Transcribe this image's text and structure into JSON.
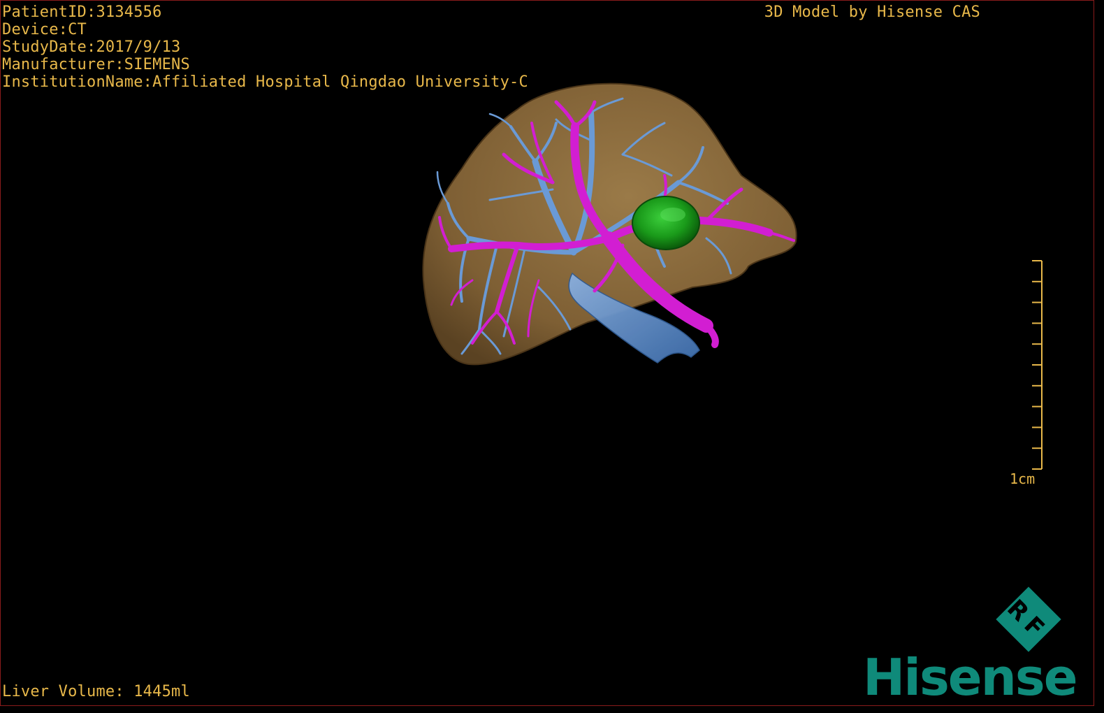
{
  "patient": {
    "patient_id": "PatientID:3134556",
    "device": "Device:CT",
    "study_date": "StudyDate:2017/9/13",
    "manufacturer": "Manufacturer:SIEMENS",
    "institution": "InstitutionName:Affiliated Hospital Qingdao University-C"
  },
  "header": {
    "caption": "3D Model by Hisense CAS"
  },
  "footer": {
    "volume": "Liver Volume: 1445ml"
  },
  "scale": {
    "label": "1cm",
    "ticks": 10
  },
  "branding": {
    "badge_text": "RF",
    "logo_text": "Hisense",
    "logo_color": "#0f8a7a"
  },
  "colors": {
    "overlay_text": "#e8b84a",
    "liver": "#8a6a3c",
    "portal_vein": "#d21ed2",
    "hepatic_vein": "#6a9ad6",
    "tumor": "#1a9a1a",
    "border": "#8a1c1c"
  },
  "model": {
    "structures": [
      "liver-surface",
      "portal-vein",
      "hepatic-vein",
      "inferior-vena-cava",
      "tumor"
    ]
  }
}
